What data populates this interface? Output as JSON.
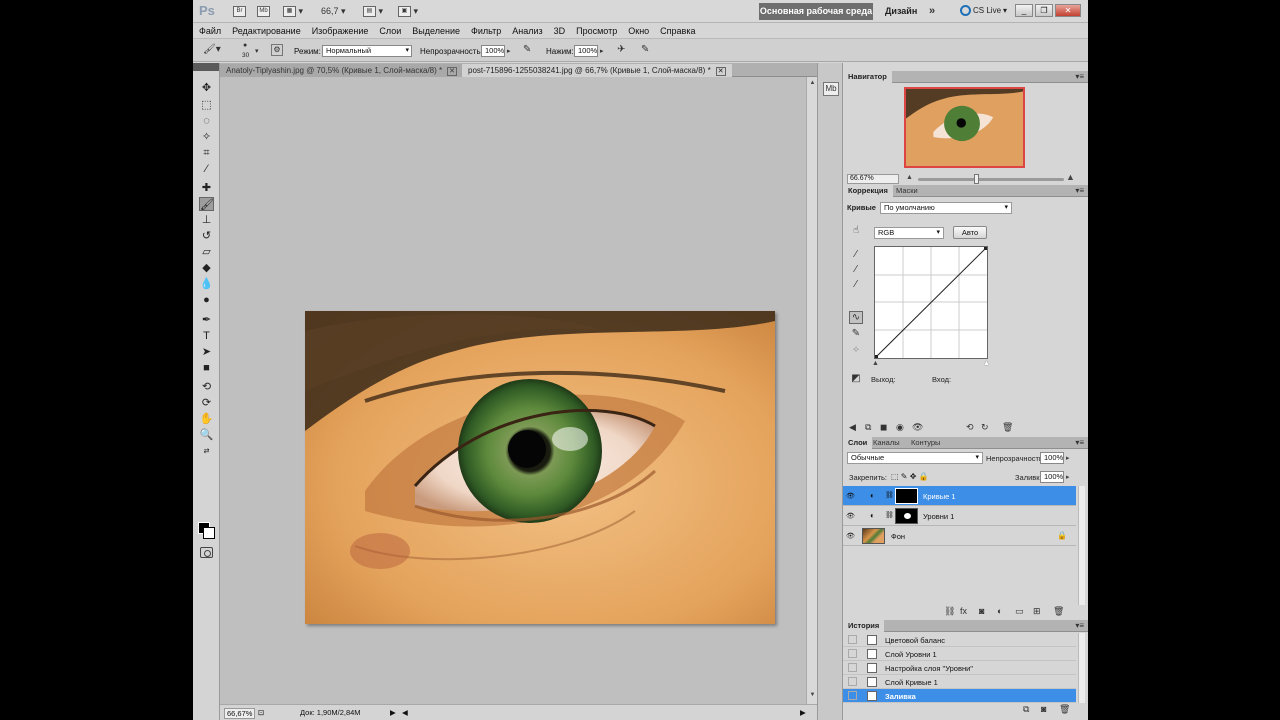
{
  "appbar": {
    "logo": "Ps",
    "mb_label": "Mb",
    "zoom": "66,7",
    "workspace_essential": "Основная рабочая среда",
    "workspace_design": "Дизайн",
    "more": "»",
    "cslive": "CS Live"
  },
  "menu": [
    "Файл",
    "Редактирование",
    "Изображение",
    "Слои",
    "Выделение",
    "Фильтр",
    "Анализ",
    "3D",
    "Просмотр",
    "Окно",
    "Справка"
  ],
  "options": {
    "brush_size": "30",
    "mode_label": "Режим:",
    "mode_value": "Нормальный",
    "opacity_label": "Непрозрачность:",
    "opacity_value": "100%",
    "flow_label": "Нажим:",
    "flow_value": "100%"
  },
  "tabs": [
    {
      "label": "Anatoly-Tiplyashin.jpg @ 70,5% (Кривые 1, Слой-маска/8) *"
    },
    {
      "label": "post-715896-1255038241.jpg @ 66,7% (Кривые 1, Слой-маска/8) *"
    }
  ],
  "status": {
    "zoom": "66,67%",
    "doc": "Док: 1,90M/2,84M"
  },
  "navigator": {
    "title": "Навигатор",
    "zoom": "66.67%"
  },
  "adjustments": {
    "tab_correction": "Коррекция",
    "tab_masks": "Маски",
    "preset_label": "Кривые",
    "preset_value": "По умолчанию",
    "channel": "RGB",
    "auto": "Авто",
    "output_label": "Выход:",
    "input_label": "Вход:"
  },
  "layers": {
    "tabs": [
      "Слои",
      "Каналы",
      "Контуры"
    ],
    "blend": "Обычные",
    "opacity_label": "Непрозрачность:",
    "opacity_value": "100%",
    "lock_label": "Закрепить:",
    "fill_label": "Заливка:",
    "fill_value": "100%",
    "items": [
      {
        "name": "Кривые 1",
        "selected": true
      },
      {
        "name": "Уровни 1",
        "selected": false
      },
      {
        "name": "Фон",
        "selected": false
      }
    ]
  },
  "history": {
    "title": "История",
    "items": [
      "Цветовой баланс",
      "Слой Уровни 1",
      "Настройка слоя \"Уровни\"",
      "Слой Кривые 1",
      "Заливка"
    ]
  }
}
